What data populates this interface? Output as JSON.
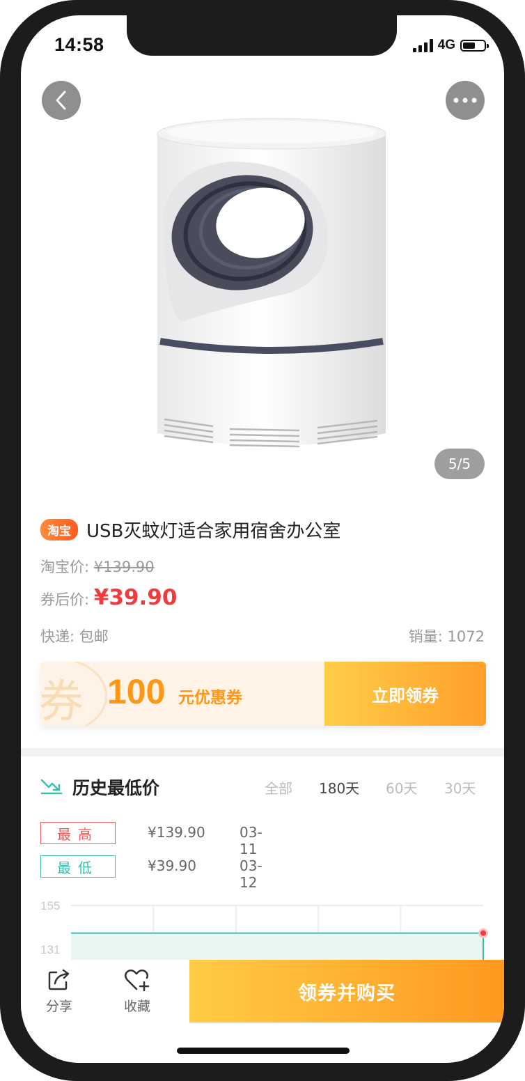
{
  "status": {
    "time": "14:58",
    "network": "4G"
  },
  "gallery": {
    "page_indicator": "5/5"
  },
  "product": {
    "platform_badge": "淘宝",
    "title": "USB灭蚊灯适合家用宿舍办公室",
    "original_price_label": "淘宝价:",
    "original_price": "¥139.90",
    "final_price_label": "券后价:",
    "final_price": "¥39.90",
    "shipping": "快递: 包邮",
    "sales": "销量: 1072"
  },
  "coupon": {
    "mark": "券",
    "amount": "100",
    "amount_label": "元优惠券",
    "claim_button": "立即领券"
  },
  "history": {
    "title": "历史最低价",
    "ranges": [
      "全部",
      "180天",
      "60天",
      "30天"
    ],
    "selected_range": "180天",
    "high": {
      "tag": "最高",
      "price": "¥139.90",
      "date": "03-11"
    },
    "low": {
      "tag": "最低",
      "price": "¥39.90",
      "date": "03-12"
    }
  },
  "chart_data": {
    "type": "line",
    "series": [
      {
        "values": [
          139.9,
          139.9,
          139.9,
          139.9,
          139.9,
          139.9,
          39.9
        ]
      }
    ],
    "y_ticks": [
      "155",
      "131"
    ],
    "ylim": [
      107,
      155
    ],
    "grid": true,
    "line_color": "#3bbfaa",
    "marker_color": "#ee3b3b"
  },
  "bottom_bar": {
    "share_label": "分享",
    "favorite_label": "收藏",
    "buy_button": "领券并购买"
  },
  "colors": {
    "price_red": "#ee3b3b",
    "accent_orange": "#ff9716",
    "teal": "#3bbfaa"
  }
}
